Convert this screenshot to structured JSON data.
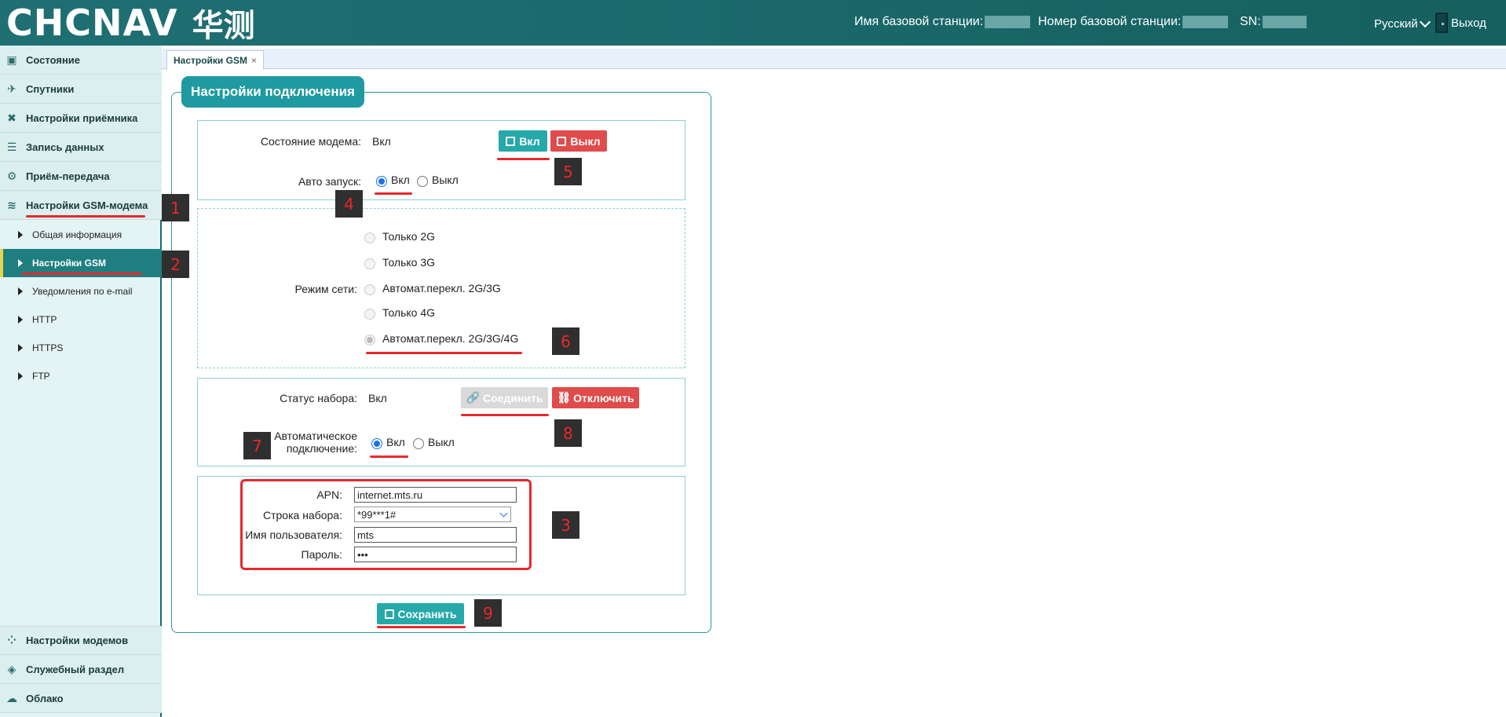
{
  "header": {
    "logo_text": "CHCNAV",
    "logo_cn": "华测",
    "base_station_name_label": "Имя базовой станции:",
    "base_station_number_label": "Номер базовой станции:",
    "sn_label": "SN:",
    "language": "Русский",
    "logout": "Выход",
    "color": "#1b6a6d"
  },
  "sidebar": {
    "items": [
      {
        "label": "Состояние",
        "icon": "monitor-icon"
      },
      {
        "label": "Спутники",
        "icon": "satellite-icon"
      },
      {
        "label": "Настройки приёмника",
        "icon": "tools-icon"
      },
      {
        "label": "Запись данных",
        "icon": "list-icon"
      },
      {
        "label": "Приём-передача",
        "icon": "gear-icon"
      },
      {
        "label": "Настройки GSM-модема",
        "icon": "wifi-icon"
      }
    ],
    "subitems": [
      {
        "label": "Общая информация"
      },
      {
        "label": "Настройки GSM"
      },
      {
        "label": "Уведомления по e-mail"
      },
      {
        "label": "HTTP"
      },
      {
        "label": "HTTPS"
      },
      {
        "label": "FTP"
      }
    ],
    "bottom_items": [
      {
        "label": "Настройки модемов",
        "icon": "modules-icon"
      },
      {
        "label": "Служебный раздел",
        "icon": "layers-icon"
      },
      {
        "label": "Облако",
        "icon": "cloud-icon"
      }
    ]
  },
  "tab": {
    "label": "Настройки GSM",
    "close": "×"
  },
  "panel": {
    "title": "Настройки подключения",
    "modem": {
      "status_label": "Состояние модема:",
      "status_value": "Вкл",
      "on_button": "Вкл",
      "off_button": "Выкл",
      "autostart_label": "Авто запуск:",
      "autostart_on": "Вкл",
      "autostart_off": "Выкл"
    },
    "network": {
      "label": "Режим сети:",
      "options": [
        "Только 2G",
        "Только 3G",
        "Автомат.перекл. 2G/3G",
        "Только 4G",
        "Автомат.перекл. 2G/3G/4G"
      ],
      "selected": "Автомат.перекл. 2G/3G/4G"
    },
    "dial": {
      "status_label": "Статус набора:",
      "status_value": "Вкл",
      "connect_button": "Соединить",
      "disconnect_button": "Отключить",
      "auto_label_line1": "Автоматическое",
      "auto_label_line2": "подключение:",
      "auto_on": "Вкл",
      "auto_off": "Выкл"
    },
    "apn": {
      "apn_label": "APN:",
      "apn_value": "internet.mts.ru",
      "dial_label": "Строка набора:",
      "dial_value": "*99***1#",
      "user_label": "Имя пользователя:",
      "user_value": "mts",
      "password_label": "Пароль:",
      "password_value": "•••"
    },
    "save_button": "Сохранить"
  },
  "annotations": [
    "1",
    "2",
    "3",
    "4",
    "5",
    "6",
    "7",
    "8",
    "9"
  ]
}
